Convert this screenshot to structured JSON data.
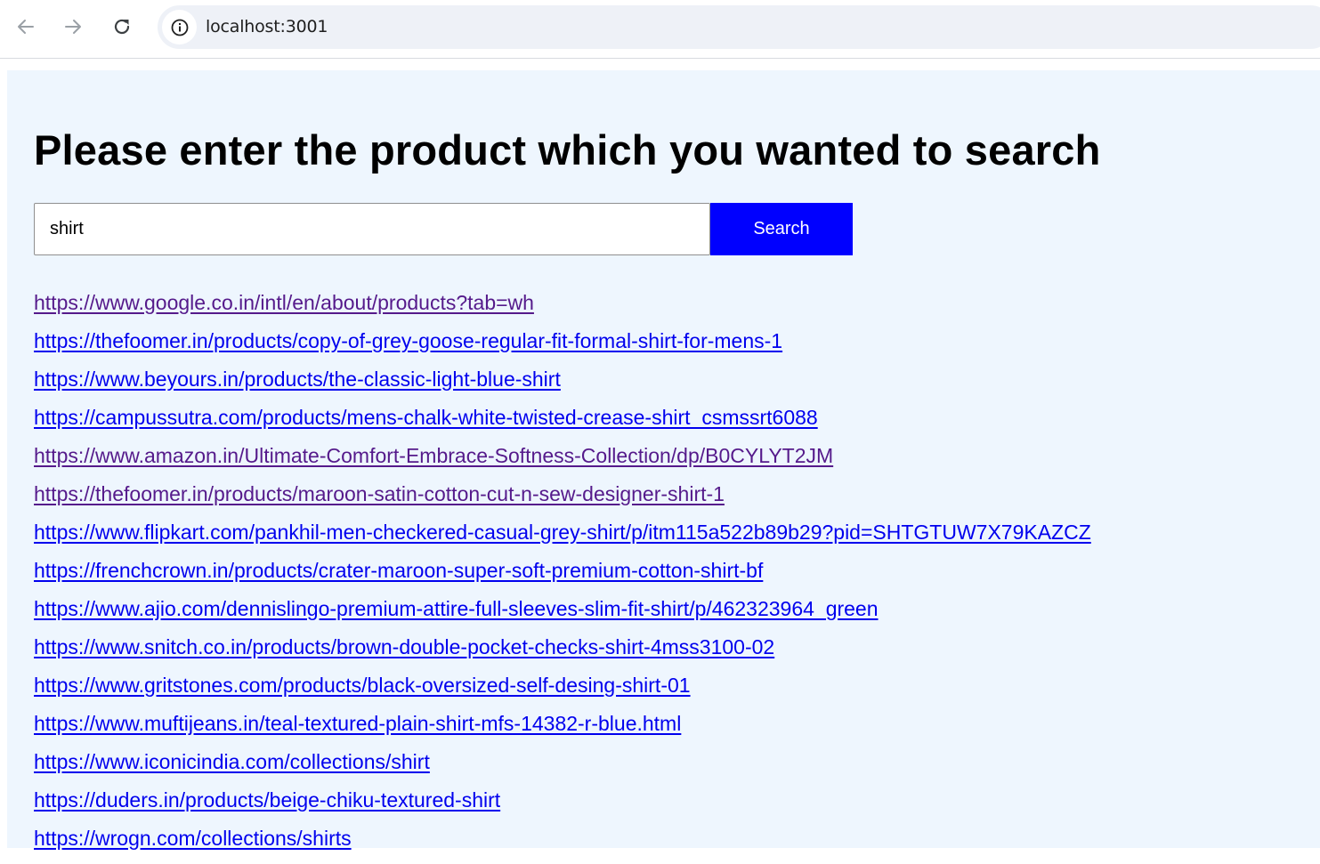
{
  "browser": {
    "url": "localhost:3001",
    "icons": {
      "back": "arrow-left-icon",
      "forward": "arrow-right-icon",
      "reload": "reload-icon",
      "site_info": "info-icon"
    }
  },
  "page": {
    "title": "Please enter the product which you wanted to search",
    "search": {
      "value": "shirt",
      "button_label": "Search"
    },
    "colors": {
      "background": "#eef6fe",
      "button": "#0000ff",
      "link": "#0000ee",
      "visited_link": "#551a8b"
    },
    "results": [
      {
        "url": "https://www.google.co.in/intl/en/about/products?tab=wh",
        "visited": true
      },
      {
        "url": "https://thefoomer.in/products/copy-of-grey-goose-regular-fit-formal-shirt-for-mens-1",
        "visited": false
      },
      {
        "url": "https://www.beyours.in/products/the-classic-light-blue-shirt",
        "visited": false
      },
      {
        "url": "https://campussutra.com/products/mens-chalk-white-twisted-crease-shirt_csmssrt6088",
        "visited": false
      },
      {
        "url": "https://www.amazon.in/Ultimate-Comfort-Embrace-Softness-Collection/dp/B0CYLYT2JM",
        "visited": true
      },
      {
        "url": "https://thefoomer.in/products/maroon-satin-cotton-cut-n-sew-designer-shirt-1",
        "visited": true
      },
      {
        "url": "https://www.flipkart.com/pankhil-men-checkered-casual-grey-shirt/p/itm115a522b89b29?pid=SHTGTUW7X79KAZCZ",
        "visited": false
      },
      {
        "url": "https://frenchcrown.in/products/crater-maroon-super-soft-premium-cotton-shirt-bf",
        "visited": false
      },
      {
        "url": "https://www.ajio.com/dennislingo-premium-attire-full-sleeves-slim-fit-shirt/p/462323964_green",
        "visited": false
      },
      {
        "url": "https://www.snitch.co.in/products/brown-double-pocket-checks-shirt-4mss3100-02",
        "visited": false
      },
      {
        "url": "https://www.gritstones.com/products/black-oversized-self-desing-shirt-01",
        "visited": false
      },
      {
        "url": "https://www.muftijeans.in/teal-textured-plain-shirt-mfs-14382-r-blue.html",
        "visited": false
      },
      {
        "url": "https://www.iconicindia.com/collections/shirt",
        "visited": false
      },
      {
        "url": "https://duders.in/products/beige-chiku-textured-shirt",
        "visited": false
      },
      {
        "url": "https://wrogn.com/collections/shirts",
        "visited": false
      }
    ]
  }
}
